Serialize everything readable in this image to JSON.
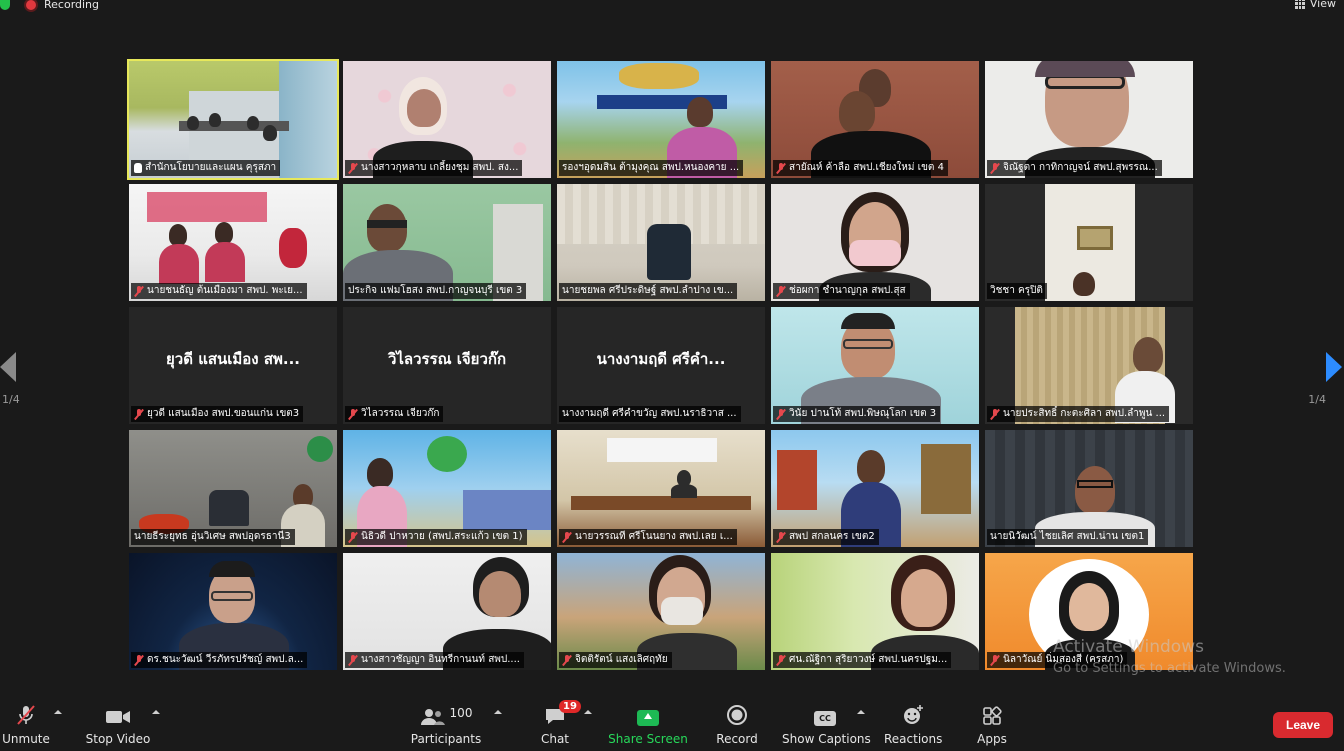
{
  "topbar": {
    "recording_label": "Recording",
    "view_label": "View"
  },
  "pagination": {
    "left": "1/4",
    "right": "1/4"
  },
  "tiles": [
    {
      "name": "สำนักนโยบายและแผน คุรุสภา",
      "muted": false,
      "icon": "raise-hand-icon",
      "active": true,
      "video": true
    },
    {
      "name": "นางสาวกุหลาบ  เกลี้ยงชุม สพป. สง...",
      "muted": true,
      "video": true
    },
    {
      "name": "รองฯอุดมสิน ต้ามุงคุณ สพป.หนองคาย ...",
      "muted": false,
      "video": true
    },
    {
      "name": "สายัณห์ ค้าลือ สพป.เชียงใหม่ เขต 4",
      "muted": true,
      "video": true
    },
    {
      "name": "จิณัฐตา กาทิกาญจน์ สพป.สุพรรณ...",
      "muted": true,
      "video": true
    },
    {
      "name": "นายชนธัญ  ต้นเมืองมา สพป. พะเย...",
      "muted": true,
      "video": true
    },
    {
      "name": "ประกิจ แฟมโฮสง สพป.กาญจนบุรี เขต 3",
      "muted": false,
      "video": true
    },
    {
      "name": "นายชยพล  ศรีประดิษฐ์ สพป.ลำปาง เข...",
      "muted": false,
      "video": true
    },
    {
      "name": "ช่อผกา ชำนาญกุล สพป.สุส",
      "muted": true,
      "video": true
    },
    {
      "name": "วิชชา ครุปิติ",
      "muted": false,
      "video": true
    },
    {
      "name": "ยุวดี แสนเมือง สพป.ขอนแก่น เขต3",
      "muted": true,
      "video": false,
      "display_name": "ยุวดี แสนเมือง สพ..."
    },
    {
      "name": "วิไลวรรณ  เจียวก๊ก",
      "muted": true,
      "video": false,
      "display_name": "วิไลวรรณ  เจียวก๊ก"
    },
    {
      "name": "นางงามฤดี  ศรีคำขวัญ สพป.นราธิวาส ...",
      "muted": false,
      "video": false,
      "display_name": "นางงามฤดี  ศรีคำ..."
    },
    {
      "name": "วินัย ปานโท้ สพป.พิษณุโลก เขต 3",
      "muted": true,
      "video": true
    },
    {
      "name": "นายประสิทธิ์  กะตะศิลา สพป.ลำพูน ...",
      "muted": true,
      "video": true
    },
    {
      "name": "นายธีระยุทธ อุ่นวิเศษ สพปอุดรธานี3",
      "muted": false,
      "video": true
    },
    {
      "name": "นิธิวดี  ปาหวาย (สพป.สระแก้ว เขต 1)",
      "muted": true,
      "video": true
    },
    {
      "name": "นายวรรณที  ศรีโนนยาง สพป.เลย เ...",
      "muted": true,
      "video": true
    },
    {
      "name": "สพป สกลนคร เขต2",
      "muted": true,
      "video": true
    },
    {
      "name": "นายนิวัฒน์ ไชยเลิศ สพป.น่าน เขต1",
      "muted": false,
      "video": true
    },
    {
      "name": "ดร.ชนะวัฒน์ วีรภัทรปรัชญ์ สพป.ล...",
      "muted": true,
      "video": true
    },
    {
      "name": "นางสาวชัญญา อินทรีกานนท์ สพป....",
      "muted": true,
      "video": true
    },
    {
      "name": "จิตติรัตน์ แสงเลิศฤทัย",
      "muted": true,
      "video": true
    },
    {
      "name": "ศน.ณัฐิกา  สุริยาวงษ์ สพป.นครปฐม...",
      "muted": true,
      "video": true
    },
    {
      "name": "นิลาวัณย์ นิ่มสองสี (ครสภา)",
      "muted": true,
      "video": true
    }
  ],
  "watermark": {
    "line1": "Activate Windows",
    "line2": "Go to Settings to activate Windows."
  },
  "toolbar": {
    "unmute": "Unmute",
    "stop_video": "Stop Video",
    "participants": "Participants",
    "participants_count": "100",
    "chat": "Chat",
    "chat_badge": "19",
    "share_screen": "Share Screen",
    "record": "Record",
    "show_captions": "Show Captions",
    "captions_icon_text": "CC",
    "reactions": "Reactions",
    "apps": "Apps",
    "leave": "Leave"
  },
  "colors": {
    "active_outline": "#e7e85b",
    "share_green": "#27d85a",
    "leave_red": "#d92a2f",
    "next_arrow": "#2d8cff",
    "mute_red": "#e5484d"
  }
}
